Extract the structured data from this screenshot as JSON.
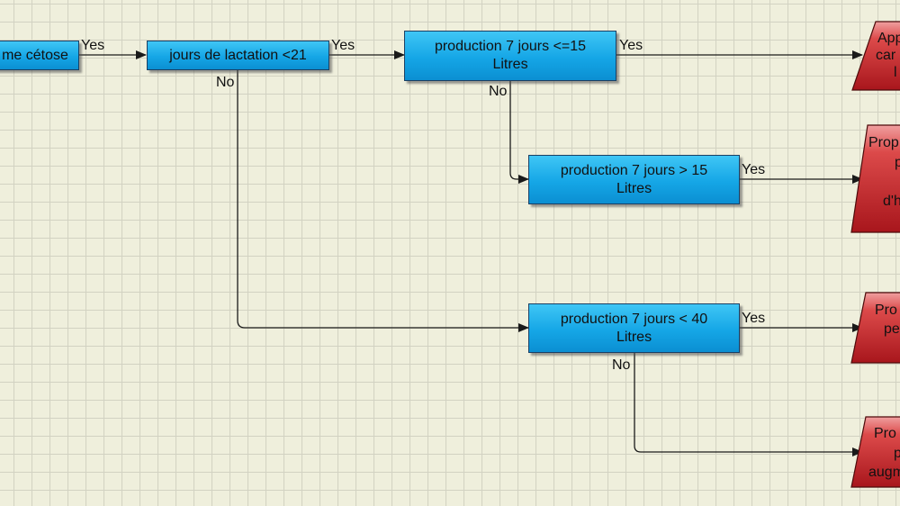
{
  "nodes": {
    "cetose": "me cétose",
    "lactation": "jours de lactation <21",
    "prod15": [
      "production 7 jours <=15",
      "Litres"
    ],
    "prodgt15": [
      "production 7 jours > 15",
      "Litres"
    ],
    "prod40": [
      "production 7 jours < 40",
      "Litres"
    ]
  },
  "labels": {
    "yes": "Yes",
    "no": "No"
  },
  "outcomes": {
    "o1": [
      "App",
      "car",
      "l"
    ],
    "o2": [
      "Prop",
      "p",
      "",
      "d'h"
    ],
    "o3": [
      "Pro",
      "pe"
    ],
    "o4": [
      "Pro",
      "p",
      "augm"
    ]
  },
  "colors": {
    "process": "#15a6e6",
    "outcome": "#c0252a",
    "connector": "#1a1a1a"
  }
}
